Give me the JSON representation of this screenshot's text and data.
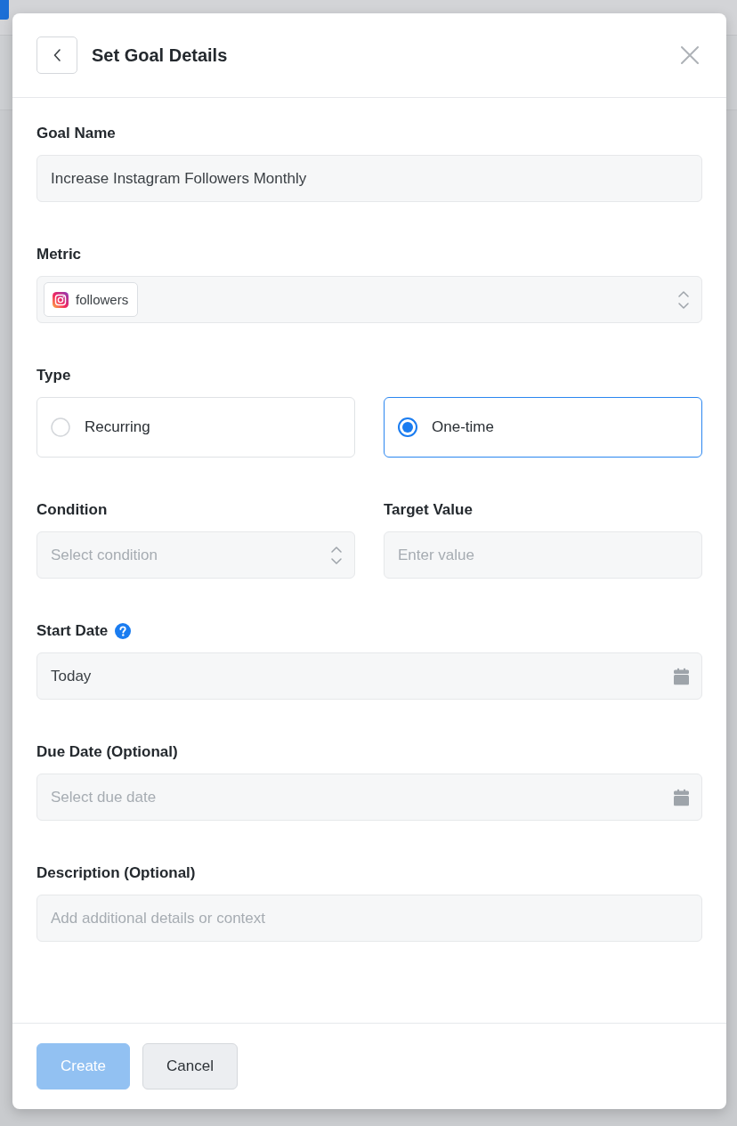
{
  "dialog": {
    "title": "Set Goal Details"
  },
  "fields": [
    {
      "kind": "text",
      "label": "Goal Name",
      "value": "Increase Instagram Followers Monthly"
    },
    {
      "kind": "chip-select",
      "label": "Metric",
      "chip": "followers"
    },
    {
      "kind": "radio-group",
      "label": "Type",
      "options": [
        {
          "label": "Recurring",
          "selected": false
        },
        {
          "label": "One-time",
          "selected": true
        }
      ]
    },
    {
      "kind": "pair",
      "items": [
        {
          "kind": "select",
          "label": "Condition",
          "placeholder": "Select condition"
        },
        {
          "kind": "text",
          "label": "Target Value",
          "placeholder": "Enter value"
        }
      ]
    },
    {
      "kind": "date",
      "label": "Start Date",
      "help": true,
      "value": "Today"
    },
    {
      "kind": "date",
      "label": "Due Date (Optional)",
      "placeholder": "Select due date"
    },
    {
      "kind": "text",
      "label": "Description (Optional)",
      "placeholder": "Add additional details or context"
    }
  ],
  "buttons": [
    {
      "label": "Create",
      "kind": "primary",
      "disabled": true
    },
    {
      "label": "Cancel",
      "kind": "secondary",
      "disabled": false
    }
  ]
}
